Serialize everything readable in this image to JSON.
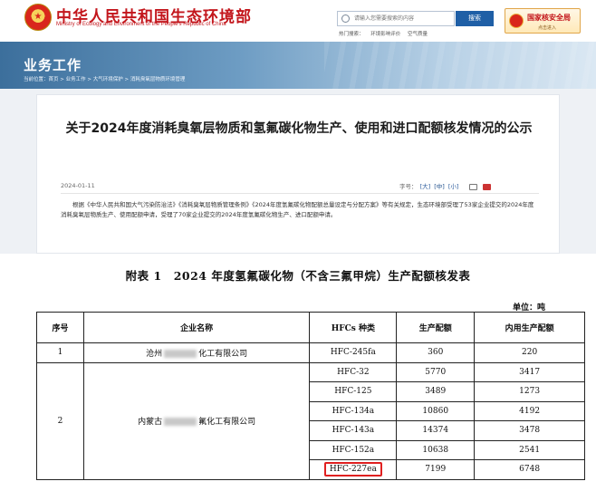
{
  "header": {
    "site_title": "中华人民共和国生态环境部",
    "site_subtitle": "Ministry of Ecology and Environment of the People's Republic of China",
    "search_placeholder": "请输入您需要搜索的内容",
    "search_button": "搜索",
    "hot_search": [
      "热门搜索：",
      "环境影响评价",
      "空气质量"
    ],
    "nna_title": "国家核安全局",
    "nna_sub": "点击进入"
  },
  "banner": {
    "section_title": "业务工作",
    "breadcrumb": "当前位置：首页 > 业务工作 > 大气环境保护 > 消耗臭氧层物质环境管理"
  },
  "article": {
    "title": "关于2024年度消耗臭氧层物质和氢氟碳化物生产、使用和进口配额核发情况的公示",
    "date": "2024-01-11",
    "font_size_label": "字号：",
    "font_sizes": [
      "[大]",
      "[中]",
      "[小]"
    ],
    "body": "根据《中华人民共和国大气污染防治法》《消耗臭氧层物质管理条例》《2024年度氢氟碳化物配额总量设定与分配方案》等有关规定，生态环境部受理了53家企业提交的2024年度消耗臭氧层物质生产、使用配额申请，受理了70家企业提交的2024年度氢氟碳化物生产、进口配额申请。"
  },
  "quota_table": {
    "title": "附表 1　2024 年度氢氟碳化物（不含三氟甲烷）生产配额核发表",
    "unit": "单位：吨",
    "headers": [
      "序号",
      "企业名称",
      "HFCs 种类",
      "生产配额",
      "内用生产配额"
    ],
    "companies": [
      {
        "no": "1",
        "name_prefix": "沧州",
        "name_suffix": "化工有限公司",
        "rows": [
          {
            "type": "HFC-245fa",
            "quota": "360",
            "internal": "220"
          }
        ]
      },
      {
        "no": "2",
        "name_prefix": "内蒙古",
        "name_suffix": "氟化工有限公司",
        "rows": [
          {
            "type": "HFC-32",
            "quota": "5770",
            "internal": "3417"
          },
          {
            "type": "HFC-125",
            "quota": "3489",
            "internal": "1273"
          },
          {
            "type": "HFC-134a",
            "quota": "10860",
            "internal": "4192"
          },
          {
            "type": "HFC-143a",
            "quota": "14374",
            "internal": "3478"
          },
          {
            "type": "HFC-152a",
            "quota": "10638",
            "internal": "2541"
          },
          {
            "type": "HFC-227ea",
            "quota": "7199",
            "internal": "6748"
          }
        ]
      }
    ]
  }
}
